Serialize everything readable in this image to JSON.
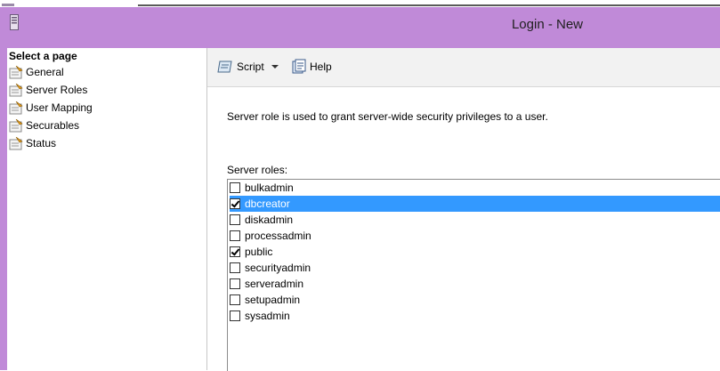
{
  "window": {
    "title": "Login - New"
  },
  "left_pane": {
    "header": "Select a page",
    "items": [
      {
        "label": "General",
        "icon": "page-icon"
      },
      {
        "label": "Server Roles",
        "icon": "page-icon"
      },
      {
        "label": "User Mapping",
        "icon": "page-icon"
      },
      {
        "label": "Securables",
        "icon": "page-icon"
      },
      {
        "label": "Status",
        "icon": "page-icon"
      }
    ]
  },
  "toolbar": {
    "script_label": "Script",
    "help_label": "Help"
  },
  "main": {
    "description": "Server role is used to grant server-wide security privileges to a user.",
    "roles_label": "Server roles:",
    "roles": [
      {
        "name": "bulkadmin",
        "checked": false,
        "selected": false
      },
      {
        "name": "dbcreator",
        "checked": true,
        "selected": true
      },
      {
        "name": "diskadmin",
        "checked": false,
        "selected": false
      },
      {
        "name": "processadmin",
        "checked": false,
        "selected": false
      },
      {
        "name": "public",
        "checked": true,
        "selected": false
      },
      {
        "name": "securityadmin",
        "checked": false,
        "selected": false
      },
      {
        "name": "serveradmin",
        "checked": false,
        "selected": false
      },
      {
        "name": "setupadmin",
        "checked": false,
        "selected": false
      },
      {
        "name": "sysadmin",
        "checked": false,
        "selected": false
      }
    ]
  },
  "colors": {
    "frame": "#c08ad8",
    "selection": "#3399ff"
  }
}
